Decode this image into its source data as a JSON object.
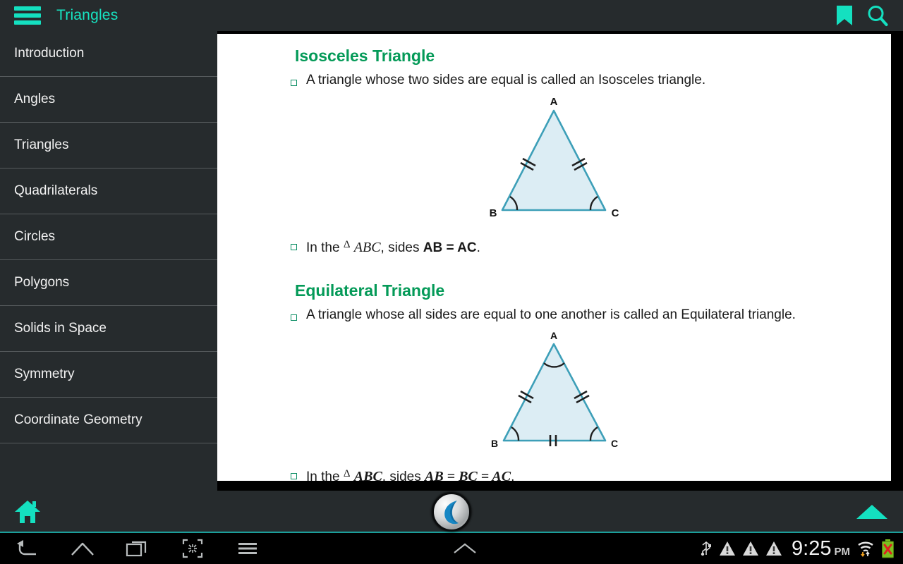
{
  "app": {
    "title": "Triangles",
    "accent_teal": "#14e0c0",
    "heading_green": "#049a58",
    "bar_bg": "#262b2d",
    "figure_stroke": "#3d9fb8",
    "figure_fill": "#dcedf4"
  },
  "topbar": {
    "menu_icon": "hamburger-icon",
    "bookmark_icon": "bookmark-icon",
    "search_icon": "search-icon"
  },
  "sidebar": {
    "items": [
      {
        "label": "Introduction"
      },
      {
        "label": "Angles"
      },
      {
        "label": "Triangles"
      },
      {
        "label": "Quadrilaterals"
      },
      {
        "label": "Circles"
      },
      {
        "label": "Polygons"
      },
      {
        "label": "Solids in Space"
      },
      {
        "label": "Symmetry"
      },
      {
        "label": "Coordinate Geometry"
      }
    ]
  },
  "content": {
    "sections": [
      {
        "heading": "Isosceles Triangle",
        "definition": "A triangle whose two sides are equal is called an Isosceles triangle.",
        "figure": {
          "name": "isosceles-triangle-figure",
          "vertices": [
            "A",
            "B",
            "C"
          ],
          "tick_sides": [
            "AB",
            "AC"
          ],
          "angle_arcs": [
            "B",
            "C"
          ]
        },
        "note_prefix": "In the",
        "note_delta": "Δ",
        "note_triangle": "ABC",
        "note_mid": ", sides",
        "note_relation": "AB = AC",
        "note_end": "."
      },
      {
        "heading": "Equilateral Triangle",
        "definition": "A triangle whose all sides are equal to one another is called an Equilateral triangle.",
        "figure": {
          "name": "equilateral-triangle-figure",
          "vertices": [
            "A",
            "B",
            "C"
          ],
          "tick_sides": [
            "AB",
            "AC",
            "BC"
          ],
          "angle_arcs": [
            "A",
            "B",
            "C"
          ]
        },
        "note_prefix": "In the",
        "note_delta": "Δ",
        "note_triangle": "ABC",
        "note_mid": ", sides",
        "note_relation": "AB = BC = AC",
        "note_end": "."
      }
    ]
  },
  "appbottom": {
    "home_icon": "home-icon",
    "night_mode_icon": "moon-icon",
    "scroll_up_icon": "triangle-up-icon"
  },
  "systembar": {
    "back_icon": "back-arrow-icon",
    "home_icon": "home-outline-icon",
    "recents_icon": "recent-apps-icon",
    "screenshot_icon": "screenshot-icon",
    "menu_icon": "menu-icon",
    "collapse_icon": "chevron-up-icon",
    "usb_icon": "usb-icon",
    "warning_icons": [
      "warning-icon",
      "warning-icon",
      "warning-icon"
    ],
    "time": "9:25",
    "meridiem": "PM",
    "wifi_icon": "wifi-icon",
    "battery_icon": "battery-error-icon"
  }
}
